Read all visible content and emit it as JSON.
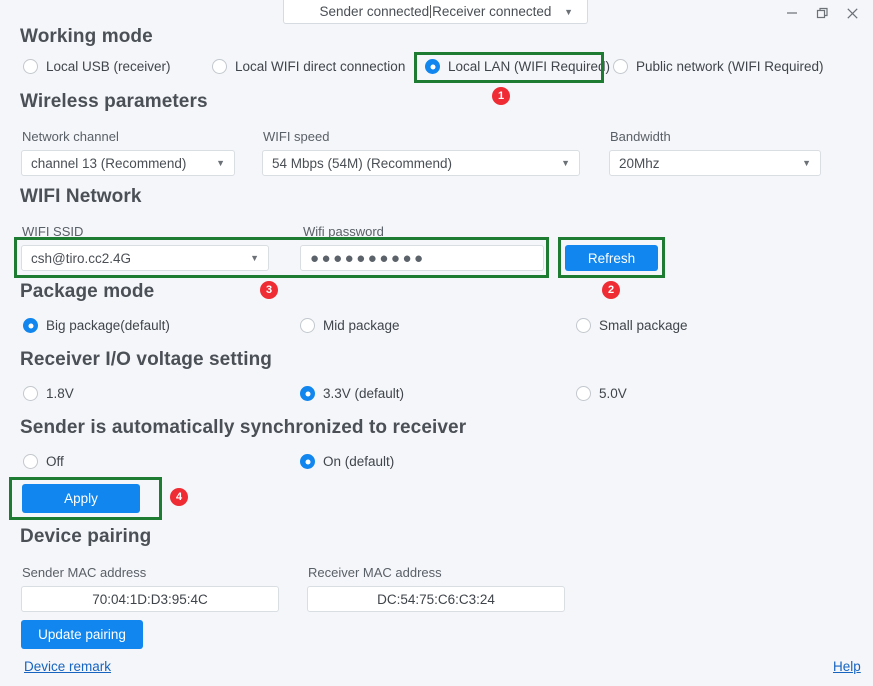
{
  "titlebar": {
    "status_prefix": "Sender connected",
    "status_suffix": "Receiver connected",
    "caret": "▼",
    "minimize": "minimize",
    "restore": "restore",
    "close": "close"
  },
  "sections": {
    "working_mode": {
      "title": "Working mode",
      "options": [
        {
          "label": "Local USB (receiver)",
          "checked": false
        },
        {
          "label": "Local WIFI direct connection",
          "checked": false
        },
        {
          "label": "Local LAN (WIFI Required)",
          "checked": true
        },
        {
          "label": "Public network (WIFI Required)",
          "checked": false
        }
      ]
    },
    "wireless_parameters": {
      "title": "Wireless parameters",
      "fields": [
        {
          "label": "Network channel",
          "value": "channel 13 (Recommend)"
        },
        {
          "label": "WIFI speed",
          "value": "54 Mbps (54M)  (Recommend)"
        },
        {
          "label": "Bandwidth",
          "value": "20Mhz"
        }
      ]
    },
    "wifi_network": {
      "title": "WIFI Network",
      "ssid_label": "WIFI SSID",
      "ssid_value": "csh@tiro.cc2.4G",
      "password_label": "Wifi password",
      "password_value": "●●●●●●●●●●",
      "refresh_label": "Refresh"
    },
    "package_mode": {
      "title": "Package mode",
      "options": [
        {
          "label": "Big package(default)",
          "checked": true
        },
        {
          "label": "Mid package",
          "checked": false
        },
        {
          "label": "Small package",
          "checked": false
        }
      ]
    },
    "io_voltage": {
      "title": "Receiver I/O voltage setting",
      "options": [
        {
          "label": "1.8V",
          "checked": false
        },
        {
          "label": "3.3V (default)",
          "checked": true
        },
        {
          "label": "5.0V",
          "checked": false
        }
      ]
    },
    "auto_sync": {
      "title": "Sender is automatically synchronized to receiver",
      "options": [
        {
          "label": "Off",
          "checked": false
        },
        {
          "label": "On (default)",
          "checked": true
        }
      ],
      "apply_label": "Apply"
    },
    "device_pairing": {
      "title": "Device pairing",
      "sender_label": "Sender MAC address",
      "sender_value": "70:04:1D:D3:95:4C",
      "receiver_label": "Receiver MAC address",
      "receiver_value": "DC:54:75:C6:C3:24",
      "update_label": "Update pairing",
      "device_remark_label": "Device remark"
    }
  },
  "footer": {
    "help_label": "Help"
  },
  "annotations": {
    "badges": [
      {
        "number": "1"
      },
      {
        "number": "2"
      },
      {
        "number": "3"
      },
      {
        "number": "4"
      }
    ],
    "highlight_color": "#1e7b32",
    "badge_color": "#ef2c34"
  },
  "colors": {
    "accent": "#1186ee",
    "background": "#f4f6f9",
    "link": "#1764c0"
  }
}
